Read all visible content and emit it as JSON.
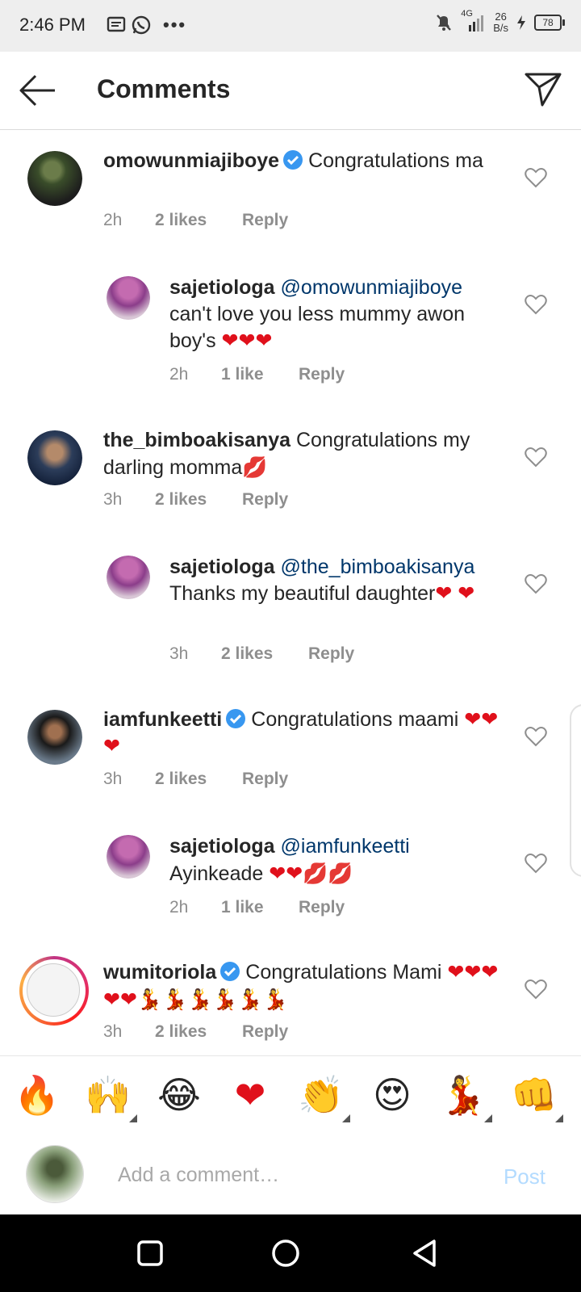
{
  "status_bar": {
    "time": "2:46 PM",
    "network": "4G",
    "speed_value": "26",
    "speed_unit": "B/s",
    "battery": "78"
  },
  "header": {
    "title": "Comments",
    "back_icon": "arrow-left-icon",
    "send_icon": "paper-plane-icon"
  },
  "comments": [
    {
      "username": "omowunmiajiboye",
      "verified": true,
      "mention": "",
      "text": "Congratulations ma",
      "time": "2h",
      "likes": "2 likes",
      "reply": "Reply",
      "is_reply": false
    },
    {
      "username": "sajetiologa",
      "verified": false,
      "mention": "@omowunmiajiboye",
      "text": "can't love you less mummy awon boy's",
      "hearts": "❤❤❤",
      "time": "2h",
      "likes": "1 like",
      "reply": "Reply",
      "is_reply": true
    },
    {
      "username": "the_bimboakisanya",
      "verified": false,
      "mention": "",
      "text": "Congratulations my darling momma",
      "emoji": "💋",
      "time": "3h",
      "likes": "2 likes",
      "reply": "Reply",
      "is_reply": false
    },
    {
      "username": "sajetiologa",
      "verified": false,
      "mention": "@the_bimboakisanya",
      "text": "Thanks my beautiful daughter",
      "hearts": "❤",
      "hearts2": "❤",
      "time": "3h",
      "likes": "2 likes",
      "reply": "Reply",
      "is_reply": true
    },
    {
      "username": "iamfunkeetti",
      "verified": true,
      "mention": "",
      "text": "Congratulations maami",
      "hearts": "❤❤❤",
      "time": "3h",
      "likes": "2 likes",
      "reply": "Reply",
      "is_reply": false
    },
    {
      "username": "sajetiologa",
      "verified": false,
      "mention": "@iamfunkeetti",
      "text": "Ayinkeade",
      "hearts": "❤❤",
      "emoji": "💋💋",
      "time": "2h",
      "likes": "1 like",
      "reply": "Reply",
      "is_reply": true
    },
    {
      "username": "wumitoriola",
      "verified": true,
      "mention": "",
      "text": "Congratulations Mami",
      "hearts": "❤❤❤❤❤",
      "emoji": "💃💃💃💃💃💃",
      "time": "3h",
      "likes": "2 likes",
      "reply": "Reply",
      "is_reply": false
    }
  ],
  "emoji_bar": [
    "🔥",
    "🙌",
    "😂",
    "❤",
    "👏",
    "😍",
    "💃",
    "👊"
  ],
  "input": {
    "placeholder": "Add a comment…",
    "post_label": "Post"
  },
  "colors": {
    "mention": "#00376b",
    "secondary_text": "#8e8e8e",
    "verified": "#3897f0",
    "heart": "#e0101b",
    "post_disabled": "#b3dbff"
  }
}
